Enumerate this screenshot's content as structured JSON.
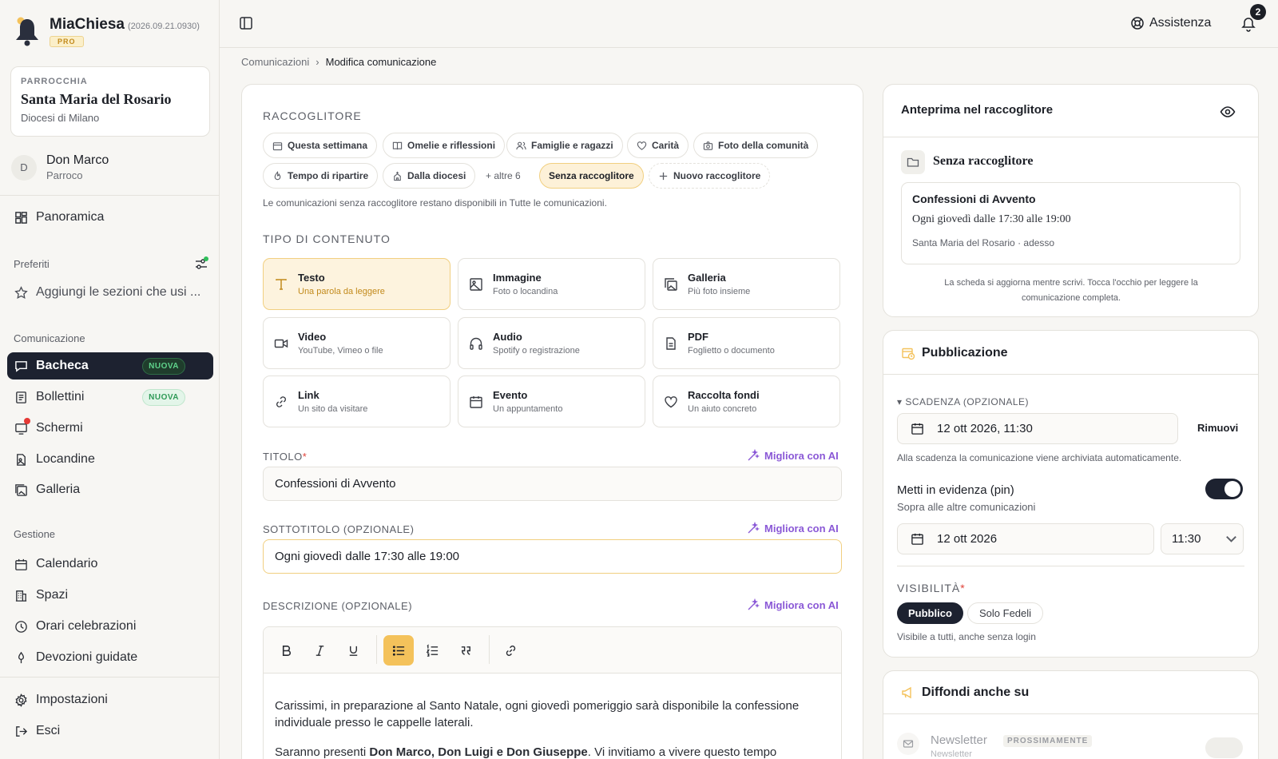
{
  "app": {
    "name": "MiaChiesa",
    "version": "(2026.09.21.0930)",
    "tier": "PRO"
  },
  "parish": {
    "label": "PARROCCHIA",
    "name": "Santa Maria del Rosario",
    "diocese": "Diocesi di Milano"
  },
  "user": {
    "initial": "D",
    "name": "Don Marco",
    "role": "Parroco"
  },
  "sidebar": {
    "overview": "Panoramica",
    "favorites_label": "Preferiti",
    "favorites_add": "Aggiungi le sezioni che usi ...",
    "comm_label": "Comunicazione",
    "comm_items": [
      {
        "label": "Bacheca",
        "badge": "NUOVA"
      },
      {
        "label": "Bollettini",
        "badge": "NUOVA"
      },
      {
        "label": "Schermi"
      },
      {
        "label": "Locandine"
      },
      {
        "label": "Galleria"
      }
    ],
    "mgmt_label": "Gestione",
    "mgmt_items": [
      {
        "label": "Calendario"
      },
      {
        "label": "Spazi"
      },
      {
        "label": "Orari celebrazioni"
      },
      {
        "label": "Devozioni guidate"
      }
    ],
    "settings": "Impostazioni",
    "logout": "Esci"
  },
  "topbar": {
    "help": "Assistenza",
    "notifications": "2"
  },
  "breadcrumb": {
    "parent": "Comunicazioni",
    "current": "Modifica comunicazione"
  },
  "form": {
    "collector_label": "RACCOGLITORE",
    "collectors": [
      {
        "label": "Questa settimana",
        "icon": "calendar-icon"
      },
      {
        "label": "Omelie e riflessioni",
        "icon": "book-icon"
      },
      {
        "label": "Famiglie e ragazzi",
        "icon": "people-icon"
      },
      {
        "label": "Carità",
        "icon": "heart-icon"
      },
      {
        "label": "Foto della comunità",
        "icon": "camera-icon"
      },
      {
        "label": "Tempo di ripartire",
        "icon": "flame-icon"
      },
      {
        "label": "Dalla diocesi",
        "icon": "church-icon"
      }
    ],
    "collector_more": "+ altre 6",
    "collector_selected": "Senza raccoglitore",
    "collector_new": "Nuovo raccoglitore",
    "collector_hint": "Le comunicazioni senza raccoglitore restano disponibili in Tutte le comunicazioni.",
    "type_label": "TIPO DI CONTENUTO",
    "types": [
      {
        "title": "Testo",
        "sub": "Una parola da leggere",
        "icon": "text-icon"
      },
      {
        "title": "Immagine",
        "sub": "Foto o locandina",
        "icon": "image-icon"
      },
      {
        "title": "Galleria",
        "sub": "Più foto insieme",
        "icon": "gallery-icon"
      },
      {
        "title": "Video",
        "sub": "YouTube, Vimeo o file",
        "icon": "video-icon"
      },
      {
        "title": "Audio",
        "sub": "Spotify o registrazione",
        "icon": "headphones-icon"
      },
      {
        "title": "PDF",
        "sub": "Foglietto o documento",
        "icon": "document-icon"
      },
      {
        "title": "Link",
        "sub": "Un sito da visitare",
        "icon": "link-icon"
      },
      {
        "title": "Evento",
        "sub": "Un appuntamento",
        "icon": "calendar-icon"
      },
      {
        "title": "Raccolta fondi",
        "sub": "Un aiuto concreto",
        "icon": "heart-icon"
      }
    ],
    "ai_label": "Migliora con AI",
    "title_label": "TITOLO",
    "title_value": "Confessioni di Avvento",
    "subtitle_label": "SOTTOTITOLO (OPZIONALE)",
    "subtitle_value": "Ogni giovedì dalle 17:30 alle 19:00",
    "desc_label": "DESCRIZIONE (OPZIONALE)",
    "desc_p1": "Carissimi, in preparazione al Santo Natale, ogni giovedì pomeriggio sarà disponibile la confessione individuale presso le cappelle laterali.",
    "desc_p2_pre": "Saranno presenti ",
    "desc_p2_bold": "Don Marco, Don Luigi e Don Giuseppe",
    "desc_p2_post": ". Vi invitiamo a vivere questo tempo"
  },
  "preview": {
    "title": "Anteprima nel raccoglitore",
    "folder": "Senza raccoglitore",
    "card_title": "Confessioni di Avvento",
    "card_sub": "Ogni giovedì dalle 17:30 alle 19:00",
    "card_meta": "Santa Maria del Rosario · adesso",
    "hint": "La scheda si aggiorna mentre scrivi. Tocca l'occhio per leggere la comunicazione completa."
  },
  "publish": {
    "title": "Pubblicazione",
    "expiry_label": "▾ SCADENZA (OPZIONALE)",
    "expiry_value": "12 ott 2026, 11:30",
    "remove": "Rimuovi",
    "expiry_hint": "Alla scadenza la comunicazione viene archiviata automaticamente.",
    "pin_title": "Metti in evidenza (pin)",
    "pin_sub": "Sopra alle altre comunicazioni",
    "pin_on": true,
    "pin_date": "12 ott 2026",
    "pin_time": "11:30",
    "visibility_label": "VISIBILITÀ",
    "vis_public": "Pubblico",
    "vis_faithful": "Solo Fedeli",
    "vis_hint": "Visibile a tutti, anche senza login"
  },
  "share": {
    "title": "Diffondi anche su",
    "newsletter": "Newsletter",
    "newsletter_badge": "PROSSIMAMENTE",
    "newsletter_sub": "Newsletter"
  },
  "colors": {
    "accent": "#f4c25b",
    "dark": "#1d2230",
    "ai": "#8a58d6",
    "success": "#2f9a57"
  }
}
